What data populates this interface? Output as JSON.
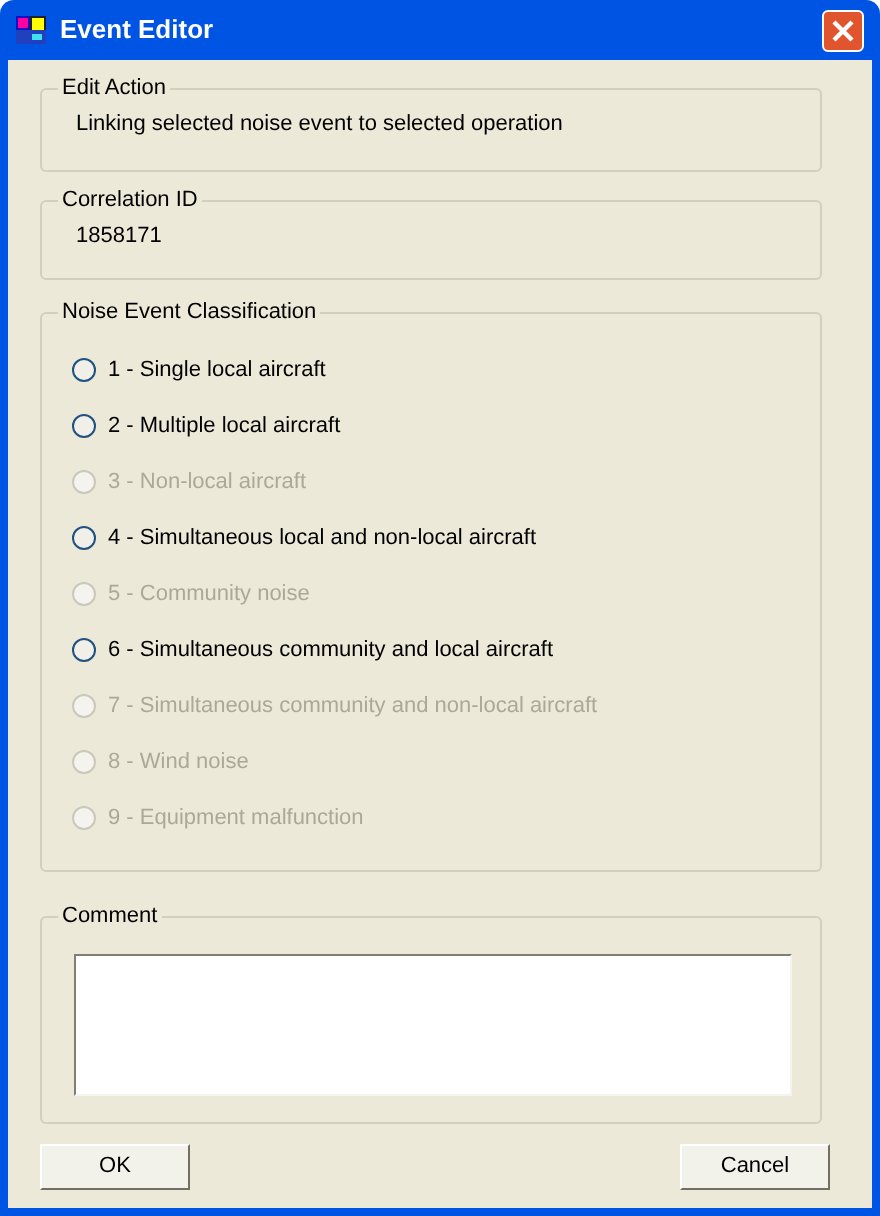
{
  "window": {
    "title": "Event Editor"
  },
  "edit_action": {
    "legend": "Edit Action",
    "text": "Linking selected noise event to selected operation"
  },
  "correlation": {
    "legend": "Correlation ID",
    "text": "1858171"
  },
  "classification": {
    "legend": "Noise Event Classification",
    "options": [
      {
        "label": "1 - Single local aircraft",
        "selected": false,
        "disabled": false
      },
      {
        "label": "2 - Multiple local aircraft",
        "selected": false,
        "disabled": false
      },
      {
        "label": "3 - Non-local aircraft",
        "selected": false,
        "disabled": true
      },
      {
        "label": "4 - Simultaneous local and non-local aircraft",
        "selected": false,
        "disabled": false
      },
      {
        "label": "5 - Community noise",
        "selected": false,
        "disabled": true
      },
      {
        "label": "6 - Simultaneous community and local aircraft",
        "selected": false,
        "disabled": false
      },
      {
        "label": "7 - Simultaneous community and non-local aircraft",
        "selected": false,
        "disabled": true
      },
      {
        "label": "8 - Wind noise",
        "selected": false,
        "disabled": true
      },
      {
        "label": "9 - Equipment malfunction",
        "selected": false,
        "disabled": true
      }
    ]
  },
  "comment": {
    "legend": "Comment"
  },
  "buttons": [
    "OK",
    "Cancel"
  ]
}
